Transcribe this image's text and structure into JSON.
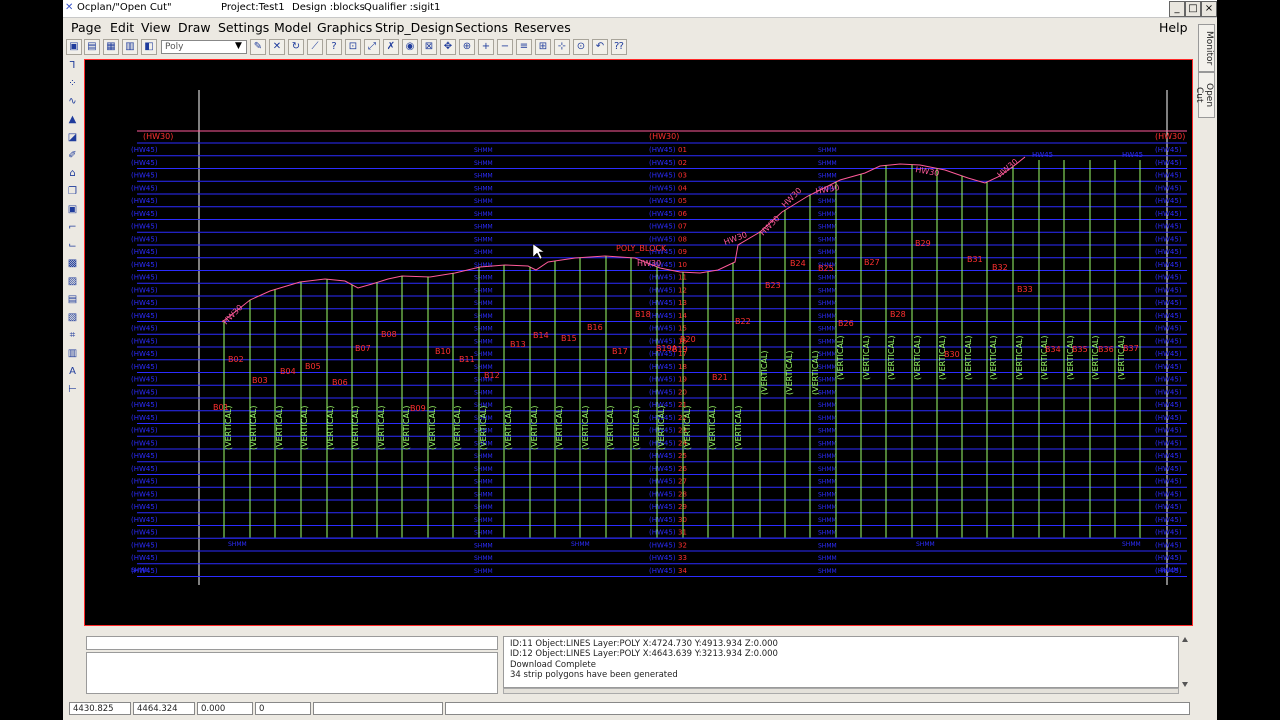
{
  "window": {
    "title": "Ocplan/\"Open Cut\"",
    "project": "Project:Test1",
    "design": "Design :blocks",
    "qualifier": "Qualifier :sigit1",
    "buttons": {
      "minimize": "_",
      "maximize": "□",
      "close": "×"
    }
  },
  "menu": {
    "items": [
      "Page",
      "Edit",
      "View",
      "Draw",
      "Settings",
      "Model",
      "Graphics",
      "Strip_Design",
      "Sections",
      "Reserves"
    ],
    "help": "Help"
  },
  "toolbar": {
    "layer_value": "Poly"
  },
  "right_tabs": [
    "Monitor",
    "Open Cut"
  ],
  "console": {
    "lines": [
      "ID:11 Object:LINES Layer:POLY X:4724.730 Y:4913.934 Z:0.000",
      "ID:12 Object:LINES Layer:POLY X:4643.639 Y:3213.934 Z:0.000",
      "Download Complete",
      "34 strip polygons have been generated"
    ]
  },
  "status": {
    "x": "4430.825",
    "y": "4464.324",
    "z": "0.000",
    "count": "0"
  },
  "drawing": {
    "hw30_label": "(HW30)",
    "hw45_label": "(HW45)",
    "swab_label": "SHMM",
    "poly_block": "POLY_BLOCK",
    "vertical": "(VERTICAL)",
    "hw30_crest": "HW30",
    "hw45_crest": "HW45",
    "block_labels": [
      "B01",
      "B02",
      "B03",
      "B04",
      "B05",
      "B06",
      "B07",
      "B08",
      "B09",
      "B10",
      "B11",
      "B12",
      "B13",
      "B14",
      "B15",
      "B16",
      "B17",
      "B18",
      "B19A",
      "B19",
      "B20",
      "B21",
      "B22",
      "B23",
      "B24",
      "B25",
      "B26",
      "B27",
      "B28",
      "B29",
      "B30",
      "B31",
      "B32",
      "B33",
      "B34",
      "B35",
      "B36",
      "B37"
    ],
    "row_labels": [
      "01",
      "02",
      "03",
      "04",
      "05",
      "06",
      "07",
      "08",
      "09",
      "10",
      "11",
      "12",
      "13",
      "14",
      "15",
      "16",
      "17",
      "18",
      "19",
      "20",
      "21",
      "22",
      "23",
      "24",
      "25",
      "26",
      "27",
      "28",
      "29",
      "30",
      "31",
      "32",
      "33",
      "34"
    ],
    "colors": {
      "background": "#000000",
      "blue_lines": "#2c2cff",
      "green_lines": "#9cff6a",
      "crest": "#ff5a9a",
      "red_text": "#ff3030",
      "frame": "#ff2a2a",
      "white_axis": "#ffffff"
    }
  }
}
